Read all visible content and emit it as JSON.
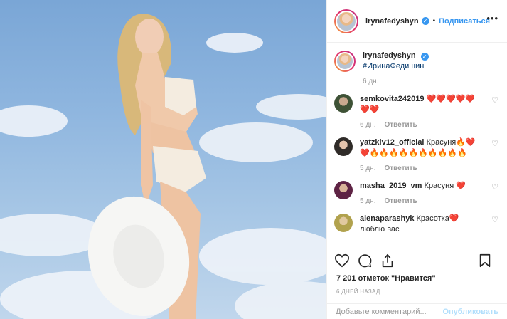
{
  "post": {
    "username": "irynafedyshyn",
    "follow_label": "Подписаться",
    "separator": "•",
    "caption_username": "irynafedyshyn",
    "caption_text": "#ИринаФедишин",
    "caption_age": "6 дн."
  },
  "comments": [
    {
      "username": "semkovita242019",
      "text": "❤️❤️❤️❤️❤️❤️❤️",
      "age": "6 дн.",
      "reply_label": "Ответить"
    },
    {
      "username": "yatzkiv12_official",
      "text": "Красуня🔥❤️❤️🔥🔥🔥🔥🔥🔥🔥🔥🔥🔥",
      "age": "5 дн.",
      "reply_label": "Ответить"
    },
    {
      "username": "masha_2019_vm",
      "text": "Красуня ❤️",
      "age": "5 дн.",
      "reply_label": "Ответить"
    },
    {
      "username": "alenaparashyk",
      "text": "Красотка❤️ люблю вас",
      "age": "",
      "reply_label": ""
    }
  ],
  "likes_text": "7 201 отметок \"Нравится\"",
  "time_text": "6 ДНЕЙ НАЗАД",
  "add_comment": {
    "placeholder": "Добавьте комментарий...",
    "publish_label": "Опубликовать"
  },
  "icons": [
    "more-icon",
    "heart-icon",
    "comment-icon",
    "share-icon",
    "bookmark-icon",
    "verified-icon"
  ],
  "colors": {
    "link": "#3897f0",
    "hashtag": "#003569",
    "muted": "#999999",
    "publish": "#b2dffc"
  }
}
